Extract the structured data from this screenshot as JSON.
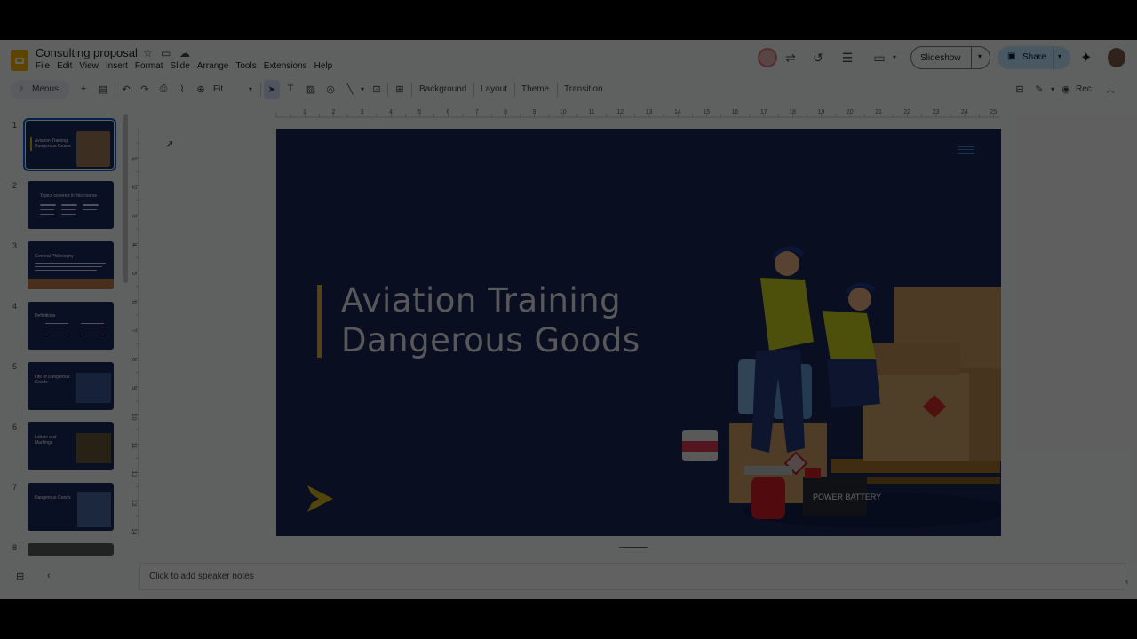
{
  "app": {
    "title": "Consulting proposal",
    "menu": [
      "File",
      "Edit",
      "View",
      "Insert",
      "Format",
      "Slide",
      "Arrange",
      "Tools",
      "Extensions",
      "Help"
    ],
    "slideshow_label": "Slideshow",
    "share_label": "Share"
  },
  "toolbar": {
    "menus_label": "Menus",
    "zoom": "Fit",
    "background_label": "Background",
    "layout_label": "Layout",
    "theme_label": "Theme",
    "transition_label": "Transition",
    "rec_label": "Rec"
  },
  "filmstrip": {
    "numbers": [
      "1",
      "2",
      "3",
      "4",
      "5",
      "6",
      "7",
      "8"
    ],
    "titles": [
      "Aviation Training Dangerous Goods",
      "Topics covered in this course",
      "General Philosophy",
      "Definitions",
      "Life of Dangerous Goods",
      "Labels and Markings",
      "Dangerous Goods",
      ""
    ]
  },
  "ruler": {
    "top": [
      "1",
      "2",
      "3",
      "4",
      "5",
      "6",
      "7",
      "8",
      "9",
      "10",
      "11",
      "12",
      "13",
      "14",
      "15",
      "16",
      "17",
      "18",
      "19",
      "20",
      "21",
      "22",
      "23",
      "24",
      "25"
    ],
    "left": [
      "1",
      "2",
      "3",
      "4",
      "5",
      "6",
      "7",
      "8",
      "9",
      "10",
      "11",
      "12",
      "13",
      "14"
    ]
  },
  "slide": {
    "title_line1": "Aviation Training",
    "title_line2": "Dangerous Goods",
    "battery_text": "POWER BATTERY",
    "accent": "#d4b51c",
    "background": "#1a2757"
  },
  "notes": {
    "placeholder": "Click to add speaker notes"
  }
}
